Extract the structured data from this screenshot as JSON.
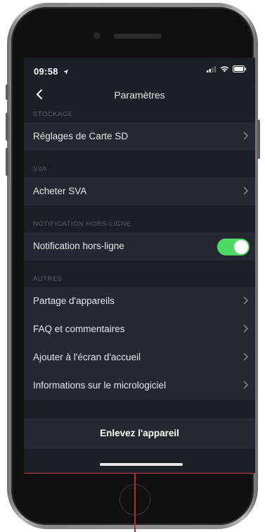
{
  "status_bar": {
    "time": "09:58",
    "location_arrow": "location-arrow-icon",
    "signal": "signal-icon",
    "wifi": "wifi-icon",
    "battery": "battery-icon"
  },
  "nav": {
    "back_icon": "chevron-left-icon",
    "title": "Paramètres"
  },
  "sections": [
    {
      "header": "STOCKAGE",
      "rows": [
        {
          "label": "Réglages de Carte SD",
          "type": "chevron"
        }
      ]
    },
    {
      "header": "SVA",
      "rows": [
        {
          "label": "Acheter SVA",
          "type": "chevron"
        }
      ]
    },
    {
      "header": "NOTIFICATION HORS-LIGNE",
      "rows": [
        {
          "label": "Notification hors-ligne",
          "type": "toggle",
          "value": true
        }
      ]
    },
    {
      "header": "AUTRES",
      "rows": [
        {
          "label": "Partage d'appareils",
          "type": "chevron"
        },
        {
          "label": "FAQ et commentaires",
          "type": "chevron"
        },
        {
          "label": "Ajouter à l'écran d'accueil",
          "type": "chevron"
        },
        {
          "label": "Informations sur le micrologiciel",
          "type": "chevron"
        }
      ]
    }
  ],
  "remove_button": {
    "label": "Enlevez l'appareil"
  },
  "colors": {
    "background": "#1c1f26",
    "row": "#252830",
    "section_header_text": "#5b5f68",
    "toggle_on": "#4cd964",
    "annotation_red": "#c0283c"
  }
}
